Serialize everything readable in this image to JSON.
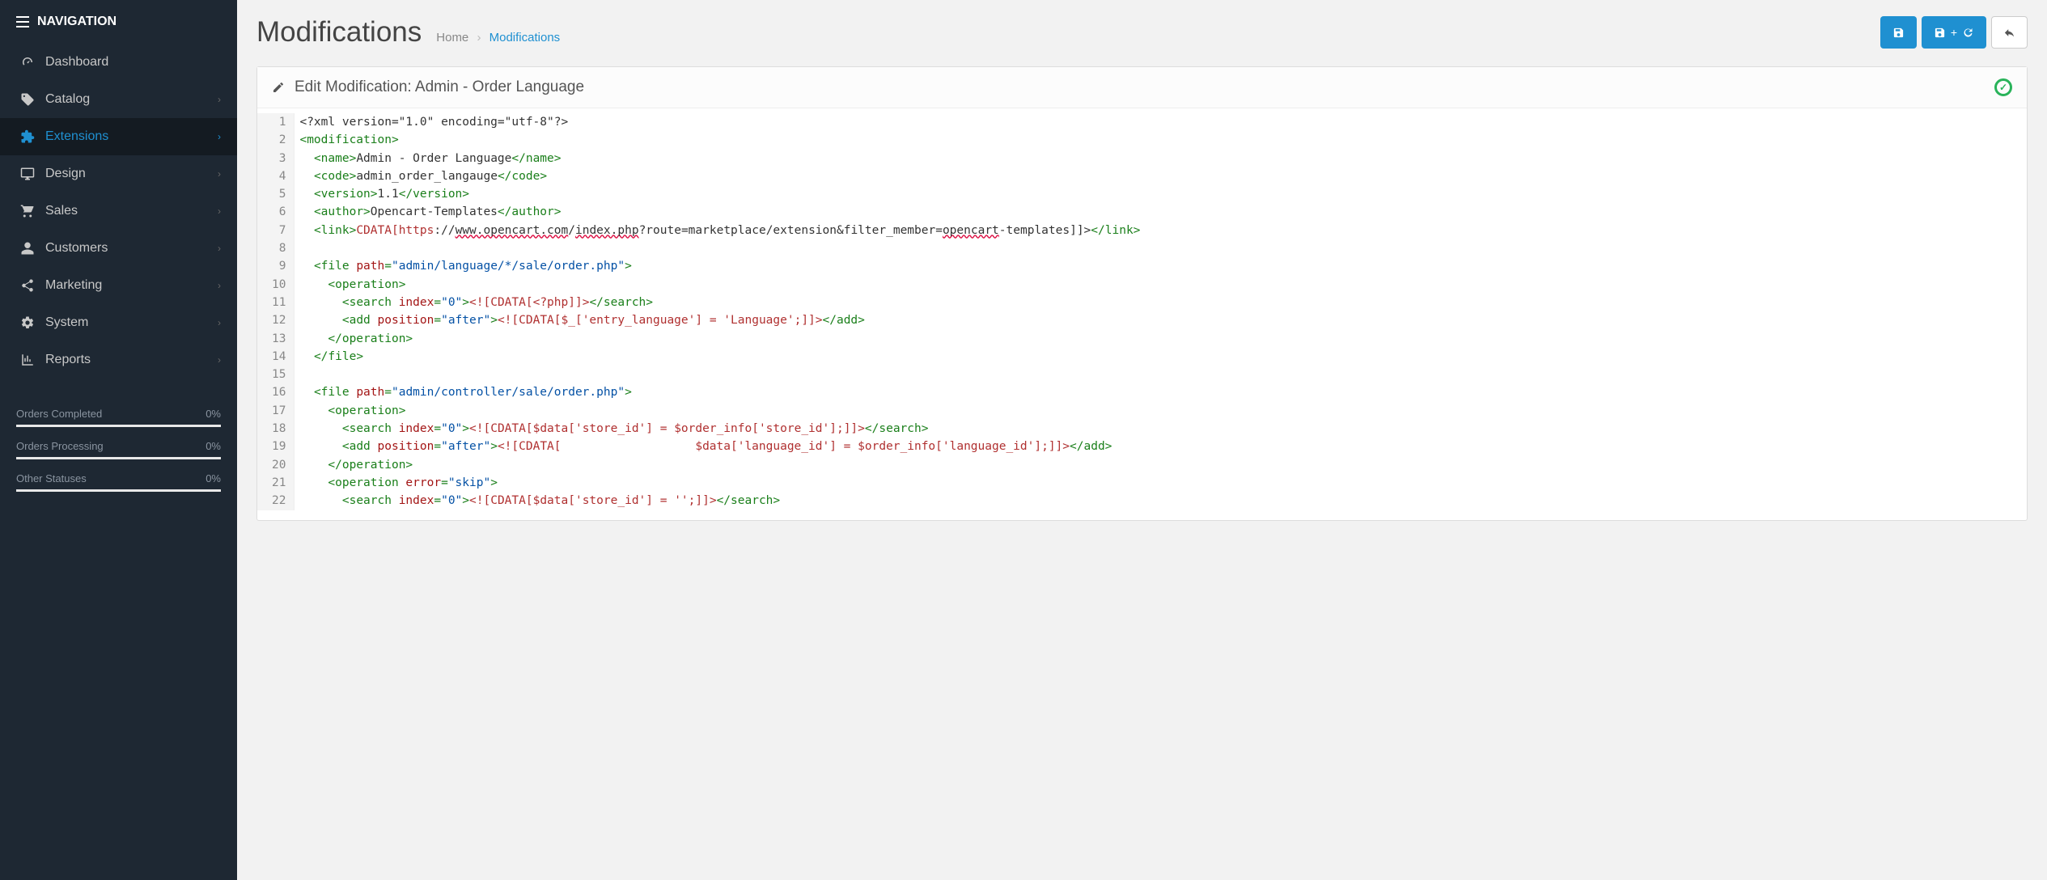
{
  "sidebar": {
    "header": "NAVIGATION",
    "items": [
      {
        "label": "Dashboard",
        "icon": "tachometer",
        "expandable": false
      },
      {
        "label": "Catalog",
        "icon": "tags",
        "expandable": true
      },
      {
        "label": "Extensions",
        "icon": "puzzle",
        "expandable": true,
        "active": true
      },
      {
        "label": "Design",
        "icon": "desktop",
        "expandable": true
      },
      {
        "label": "Sales",
        "icon": "cart",
        "expandable": true
      },
      {
        "label": "Customers",
        "icon": "user",
        "expandable": true
      },
      {
        "label": "Marketing",
        "icon": "share",
        "expandable": true
      },
      {
        "label": "System",
        "icon": "gear",
        "expandable": true
      },
      {
        "label": "Reports",
        "icon": "bar-chart",
        "expandable": true
      }
    ],
    "stats": [
      {
        "label": "Orders Completed",
        "value": "0%"
      },
      {
        "label": "Orders Processing",
        "value": "0%"
      },
      {
        "label": "Other Statuses",
        "value": "0%"
      }
    ]
  },
  "header": {
    "title": "Modifications",
    "breadcrumb": {
      "home": "Home",
      "current": "Modifications"
    },
    "buttons": {
      "save": "save",
      "save_refresh": "save+refresh",
      "back": "back"
    }
  },
  "panel": {
    "title_prefix": "Edit Modification: ",
    "title_value": "Admin - Order Language"
  },
  "code": {
    "line_start": 1,
    "line_end": 22,
    "mod_name": "Admin - Order Language",
    "mod_code": "admin_order_langauge",
    "mod_version": "1.1",
    "mod_author": "Opencart-Templates",
    "mod_link_prefix": "<![",
    "mod_link_cdata": "CDATA[https",
    "mod_link_mid1": "://",
    "mod_link_host": "www.opencart.com",
    "mod_link_path": "/",
    "mod_link_index": "index.php",
    "mod_link_query1": "?route=marketplace/extension&filter_member=",
    "mod_link_member": "opencart",
    "mod_link_tail": "-templates]]>",
    "file1_path": "admin/language/*/sale/order.php",
    "file1_search_index": "0",
    "file1_search_cdata": "<![CDATA[<?php]]>",
    "file1_add_position": "after",
    "file1_add_cdata": "<![CDATA[$_['entry_language'] = 'Language';]]>",
    "file2_path": "admin/controller/sale/order.php",
    "file2_search_index": "0",
    "file2_search_cdata": "<![CDATA[$data['store_id'] = $order_info['store_id'];]]>",
    "file2_add_position": "after",
    "file2_add_cdata": "<![CDATA[\t\t\t$data['language_id'] = $order_info['language_id'];]]>",
    "file2_op2_error": "skip",
    "file2_op2_search_index": "0",
    "file2_op2_search_cdata": "<![CDATA[$data['store_id'] = '';]]>"
  }
}
